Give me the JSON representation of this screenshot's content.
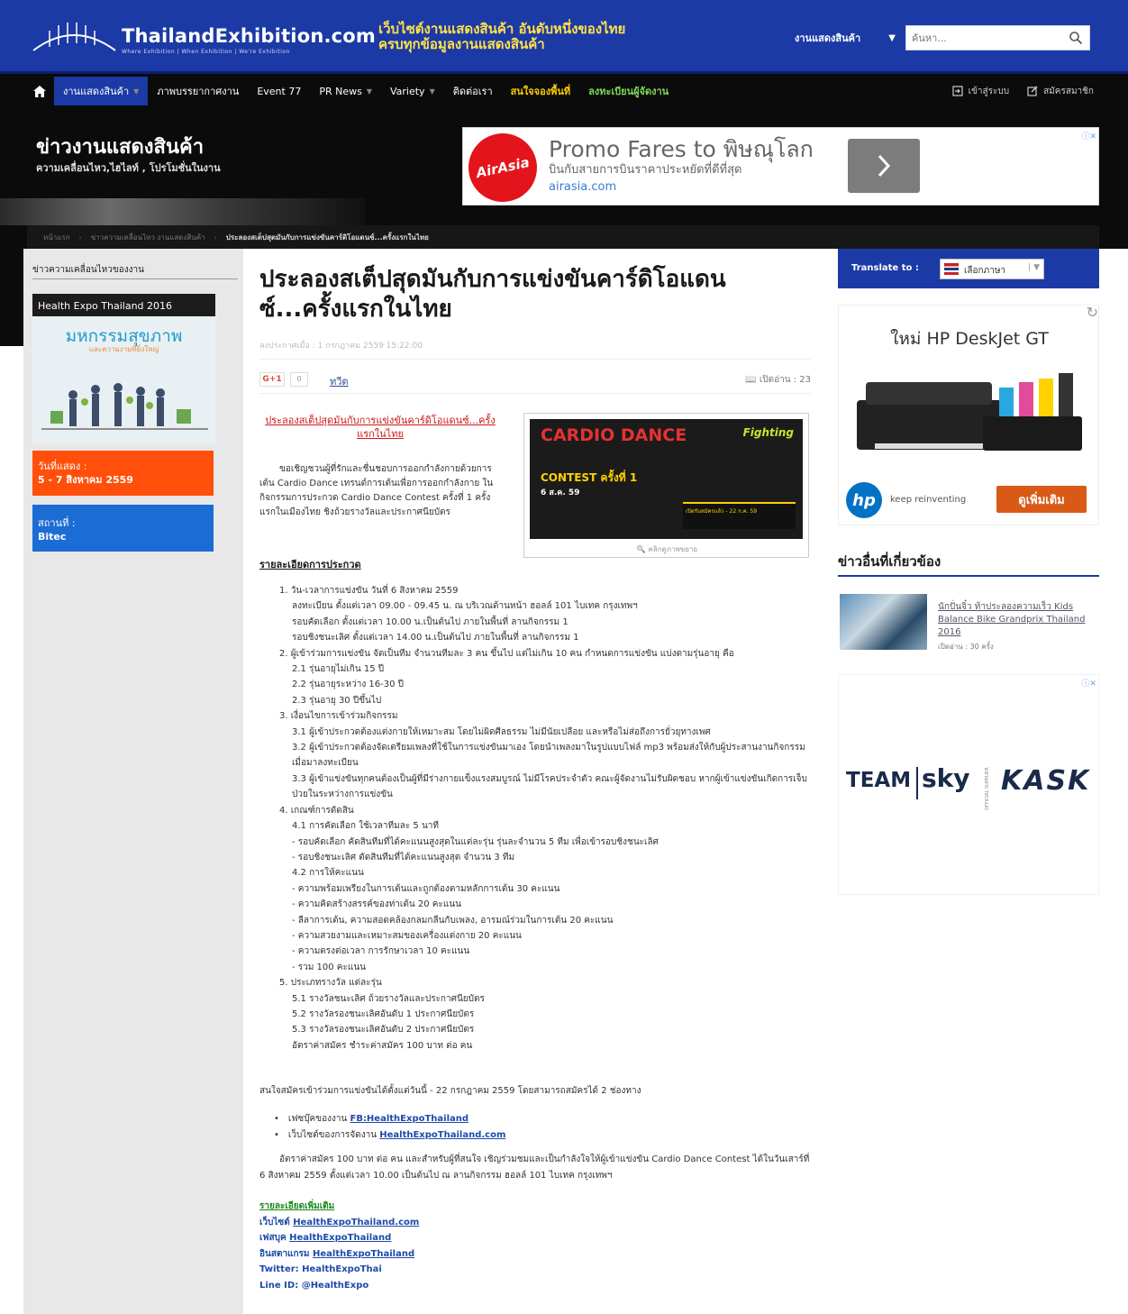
{
  "header": {
    "site_name": "ThailandExhibition.com",
    "site_tagline": "Where Exhibition | When Exhibition | We're Exhibition",
    "slogan_line1": "เว็บไซต์งานแสดงสินค้า อันดับหนึ่งของไทย",
    "slogan_line2": "ครบทุกข้อมูลงานแสดงสินค้า",
    "search_category": "งานแสดงสินค้า",
    "search_placeholder": "ค้นหา..."
  },
  "nav": {
    "items": [
      {
        "label": "งานแสดงสินค้า",
        "active": true,
        "caret": true
      },
      {
        "label": "ภาพบรรยากาศงาน",
        "active": false,
        "caret": false
      },
      {
        "label": "Event 77",
        "active": false,
        "caret": false
      },
      {
        "label": "PR News",
        "active": false,
        "caret": true
      },
      {
        "label": "Variety",
        "active": false,
        "caret": true
      },
      {
        "label": "ติดต่อเรา",
        "active": false,
        "caret": false
      },
      {
        "label": "สนใจจองพื้นที่",
        "active": false,
        "caret": false,
        "style": "yellow"
      },
      {
        "label": "ลงทะเบียนผู้จัดงาน",
        "active": false,
        "caret": false,
        "style": "green"
      }
    ],
    "login": "เข้าสู่ระบบ",
    "register": "สมัครสมาชิก"
  },
  "section": {
    "title": "ข่าวงานแสดงสินค้า",
    "subtitle": "ความเคลื่อนไหว,ไฮไลท์ , โปรโมชั่นในงาน"
  },
  "ad_airasia": {
    "logo": "AirAsia",
    "headline": "Promo Fares to พิษณุโลก",
    "subline": "บินกับสายการบินราคาประหยัดที่ดีที่สุด",
    "url": "airasia.com"
  },
  "breadcrumb": {
    "home": "หน้าแรก",
    "parent": "ข่าวความเคลื่อนไหว งานแสดงสินค้า",
    "current": "ประลองสเต็ปสุดมันกับการแข่งขันคาร์ดิโอแดนซ์...ครั้งแรกในไทย"
  },
  "left": {
    "title": "ข่าวความเคลื่อนไหวของงาน",
    "expo_header": "Health Expo Thailand 2016",
    "expo_big": "มหกรรมสุขภาพ",
    "expo_small": "และความงามที่ยิ่งใหญ่",
    "date_label": "วันที่แสดง :",
    "date_value": "5 - 7 สิงหาคม 2559",
    "venue_label": "สถานที่ :",
    "venue_value": "Bitec"
  },
  "article": {
    "title": "ประลองสเต็ปสุดมันกับการแข่งขันคาร์ดิโอแดนซ์...ครั้งแรกในไทย",
    "date": "ลงประกาศเมื่อ : 1 กรกฎาคม 2559 15:22:00",
    "gplus": "G+1",
    "gcount": "0",
    "tweet": "ทวีต",
    "readcount": "เปิดอ่าน : 23",
    "intro_link": "ประลองสเต็ปสุดมันกับการแข่งขันคาร์ดิโอแดนซ์...ครั้งแรกในไทย",
    "intro_text": "ขอเชิญชวนผู้ที่รักและชื่นชอบการออกกำลังกายด้วยการเต้น Cardio Dance เทรนด์การเต้นเพื่อการออกกำลังกาย ในกิจกรรมการประกวด Cardio Dance Contest ครั้งที่ 1 ครั้งแรกในเมืองไทย ชิงถ้วยรางวัลและประกาศนียบัตร",
    "poster_title": "CARDIO DANCE",
    "poster_sub": "CONTEST ครั้งที่ 1",
    "poster_date": "6 ส.ค. 59",
    "poster_brand": "Fighting",
    "poster_strip": "เปิดรับสมัครแล้ว - 22 ก.ค. 59",
    "poster_caption": "คลิกดูภาพขยาย",
    "details_head": "รายละเอียดการประกวด",
    "details": [
      {
        "lvl": 1,
        "text": "1. วัน-เวลาการแข่งขัน วันที่ 6 สิงหาคม 2559"
      },
      {
        "lvl": 2,
        "text": "ลงทะเบียน ตั้งแต่เวลา 09.00 - 09.45 น. ณ บริเวณด้านหน้า ฮอลล์ 101 ไบเทค กรุงเทพฯ"
      },
      {
        "lvl": 2,
        "text": "รอบคัดเลือก ตั้งแต่เวลา 10.00 น.เป็นต้นไป ภายในพื้นที่ ลานกิจกรรม 1"
      },
      {
        "lvl": 2,
        "text": "รอบชิงชนะเลิศ ตั้งแต่เวลา 14.00 น.เป็นต้นไป ภายในพื้นที่ ลานกิจกรรม 1"
      },
      {
        "lvl": 1,
        "text": "2. ผู้เข้าร่วมการแข่งขัน จัดเป็นทีม จำนวนทีมละ 3 คน ขึ้นไป แต่ไม่เกิน 10 คน กำหนดการแข่งขัน แบ่งตามรุ่นอายุ คือ"
      },
      {
        "lvl": 2,
        "text": "2.1 รุ่นอายุไม่เกิน 15 ปี"
      },
      {
        "lvl": 2,
        "text": "2.2 รุ่นอายุระหว่าง 16-30 ปี"
      },
      {
        "lvl": 2,
        "text": "2.3 รุ่นอายุ 30 ปีขึ้นไป"
      },
      {
        "lvl": 1,
        "text": "3. เงื่อนไขการเข้าร่วมกิจกรรม"
      },
      {
        "lvl": 2,
        "text": "3.1 ผู้เข้าประกวดต้องแต่งกายให้เหมาะสม โดยไม่ผิดศีลธรรม ไม่มีนัยเปลือย และหรือไม่ส่อถึงการยั่วยุทางเพศ"
      },
      {
        "lvl": 2,
        "text": "3.2 ผู้เข้าประกวดต้องจัดเตรียมเพลงที่ใช้ในการแข่งขันมาเอง โดยนำเพลงมาในรูปแบบไฟล์ mp3 พร้อมส่งให้กับผู้ประสานงานกิจกรรม เมื่อมาลงทะเบียน"
      },
      {
        "lvl": 2,
        "text": "3.3 ผู้เข้าแข่งขันทุกคนต้องเป็นผู้ที่มีร่างกายแข็งแรงสมบูรณ์ ไม่มีโรคประจำตัว คณะผู้จัดงานไม่รับผิดชอบ หากผู้เข้าแข่งขันเกิดการเจ็บป่วยในระหว่างการแข่งขัน"
      },
      {
        "lvl": 1,
        "text": "4. เกณฑ์การตัดสิน"
      },
      {
        "lvl": 2,
        "text": "4.1 การคัดเลือก ใช้เวลาทีมละ 5 นาที"
      },
      {
        "lvl": 2,
        "text": "- รอบคัดเลือก คัดสินทีมที่ได้คะแนนสูงสุดในแต่ละรุ่น รุ่นละจำนวน 5 ทีม เพื่อเข้ารอบชิงชนะเลิศ"
      },
      {
        "lvl": 2,
        "text": "- รอบชิงชนะเลิศ ตัดสินทีมที่ได้คะแนนสูงสุด จำนวน 3 ทีม"
      },
      {
        "lvl": 2,
        "text": "4.2 การให้คะแนน"
      },
      {
        "lvl": 2,
        "text": "- ความพร้อมเพรียงในการเต้นและถูกต้องตามหลักการเต้น 30 คะแนน"
      },
      {
        "lvl": 2,
        "text": "- ความคิดสร้างสรรค์ของท่าเต้น 20 คะแนน"
      },
      {
        "lvl": 2,
        "text": "- ลีลาการเต้น, ความสอดคล้องกลมกลืนกับเพลง, อารมณ์ร่วมในการเต้น 20 คะแนน"
      },
      {
        "lvl": 2,
        "text": "- ความสวยงามและเหมาะสมของเครื่องแต่งกาย 20 คะแนน"
      },
      {
        "lvl": 2,
        "text": "- ความตรงต่อเวลา การรักษาเวลา 10 คะแนน"
      },
      {
        "lvl": 2,
        "text": "- รวม 100 คะแนน"
      },
      {
        "lvl": 1,
        "text": "5. ประเภทรางวัล แต่ละรุ่น"
      },
      {
        "lvl": 2,
        "text": "5.1 รางวัลชนะเลิศ ถ้วยรางวัลและประกาศนียบัตร"
      },
      {
        "lvl": 2,
        "text": "5.2 รางวัลรองชนะเลิศอันดับ 1 ประกาศนียบัตร"
      },
      {
        "lvl": 2,
        "text": "5.3 รางวัลรองชนะเลิศอันดับ 2 ประกาศนียบัตร"
      },
      {
        "lvl": 2,
        "text": "อัตราค่าสมัคร ชำระค่าสมัคร 100 บาท ต่อ คน"
      }
    ],
    "deadline": "สนใจสมัครเข้าร่วมการแข่งขันได้ตั้งแต่วันนี้ - 22 กรกฎาคม 2559 โดยสามารถสมัครได้ 2 ช่องทาง",
    "links": [
      {
        "prefix": "เฟซบุ๊คของงาน",
        "link": "FB:HealthExpoThailand"
      },
      {
        "prefix": "เว็บไซต์ของการจัดงาน",
        "link": "HealthExpoThailand.com"
      }
    ],
    "fee_text": "อัตราค่าสมัคร 100 บาท ต่อ คน และสำหรับผู้ที่สนใจ เชิญร่วมชมและเป็นกำลังใจให้ผู้เข้าแข่งขัน Cardio Dance Contest ได้ในวันเสาร์ที่ 6 สิงหาคม 2559 ตั้งแต่เวลา 10.00 เป็นต้นไป ณ ลานกิจกรรม ฮอลล์ 101 ไบเทค กรุงเทพฯ",
    "more_head": "รายละเอียดเพิ่มเติม",
    "more": [
      {
        "label": "เว็บไซต์",
        "value": "HealthExpoThailand.com"
      },
      {
        "label": "เฟสบุค",
        "value": "HealthExpoThailand"
      },
      {
        "label": "อินสตาแกรม",
        "value": "HealthExpoThailand"
      },
      {
        "label": "Twitter:",
        "value": "HealthExpoThai"
      },
      {
        "label": "Line ID:",
        "value": "@HealthExpo"
      }
    ]
  },
  "right": {
    "translate_label": "Translate to :",
    "translate_select": "เลือกภาษา",
    "hp_title": "ใหม่ HP DeskJet GT",
    "hp_tagline": "keep reinventing",
    "hp_button": "ดูเพิ่มเติม",
    "related_title": "ข่าวอื่นที่เกี่ยวข้อง",
    "related_item": "นักปั่นจิ๋ว ท้าประลองความเร็ว Kids Balance Bike Grandprix Thailand 2016",
    "related_count": "เปิดอ่าน : 30 ครั้ง",
    "team_ad_team": "TEAM",
    "team_ad_sky": "sky",
    "team_ad_kask": "KASK",
    "team_ad_supplier": "OFFICIAL SUPPLIER"
  },
  "colors": {
    "brand_blue": "#1c3aa5",
    "nav_black": "#0b0b0b",
    "orange": "#ff4f0a",
    "venue_blue": "#1c6cd6",
    "link_blue": "#1e4aa8"
  }
}
